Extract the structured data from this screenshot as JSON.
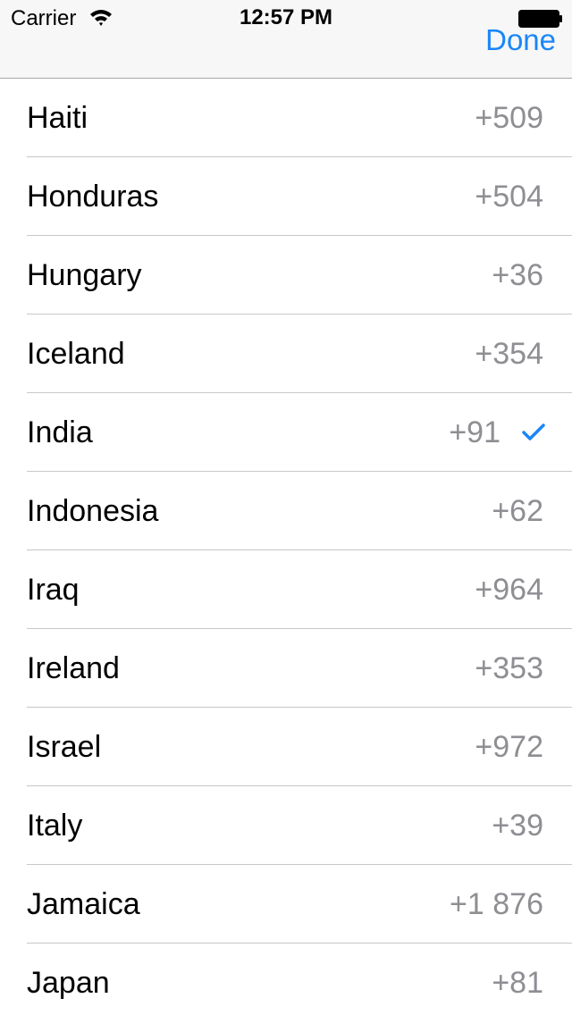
{
  "status_bar": {
    "carrier": "Carrier",
    "time": "12:57 PM"
  },
  "nav": {
    "done_label": "Done"
  },
  "colors": {
    "accent": "#1a86f8",
    "secondary_text": "#8e8e93",
    "separator": "#c8c7cc"
  },
  "countries": [
    {
      "name": "Haiti",
      "code": "+509",
      "selected": false
    },
    {
      "name": "Honduras",
      "code": "+504",
      "selected": false
    },
    {
      "name": "Hungary",
      "code": "+36",
      "selected": false
    },
    {
      "name": "Iceland",
      "code": "+354",
      "selected": false
    },
    {
      "name": "India",
      "code": "+91",
      "selected": true
    },
    {
      "name": "Indonesia",
      "code": "+62",
      "selected": false
    },
    {
      "name": "Iraq",
      "code": "+964",
      "selected": false
    },
    {
      "name": "Ireland",
      "code": "+353",
      "selected": false
    },
    {
      "name": "Israel",
      "code": "+972",
      "selected": false
    },
    {
      "name": "Italy",
      "code": "+39",
      "selected": false
    },
    {
      "name": "Jamaica",
      "code": "+1 876",
      "selected": false
    },
    {
      "name": "Japan",
      "code": "+81",
      "selected": false
    }
  ]
}
